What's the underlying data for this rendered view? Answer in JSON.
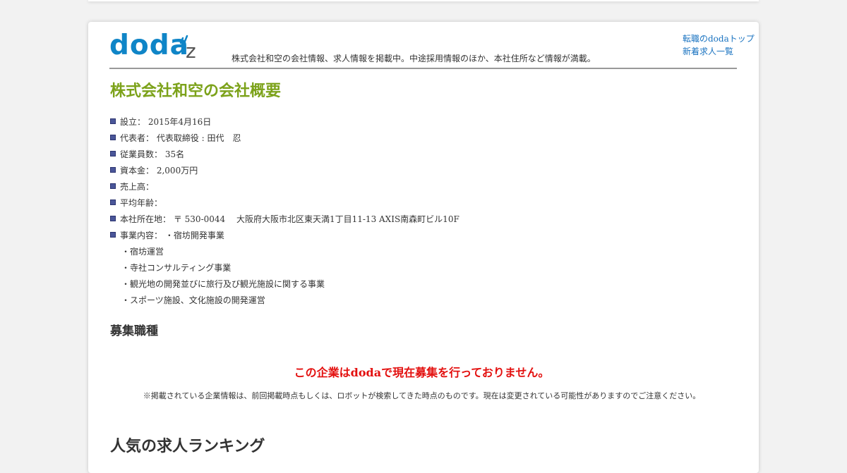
{
  "header": {
    "logo_text": "doda",
    "logo_suffix": "z",
    "tagline": "株式会社和空の会社情報、求人情報を掲載中。中途採用情報のほか、本社住所など情報が満載。",
    "links": [
      "転職のdodaトップ",
      "新着求人一覧"
    ]
  },
  "page_title": "株式会社和空の会社概要",
  "company_info": [
    {
      "label": "設立：",
      "value": "2015年4月16日"
    },
    {
      "label": "代表者：",
      "value": "代表取締役 : 田代　忍"
    },
    {
      "label": "従業員数：",
      "value": "35名"
    },
    {
      "label": "資本金：",
      "value": "2,000万円"
    },
    {
      "label": "売上高：",
      "value": ""
    },
    {
      "label": "平均年齢：",
      "value": ""
    },
    {
      "label": "本社所在地：",
      "value": "〒 530-0044　 大阪府大阪市北区東天満1丁目11-13 AXIS南森町ビル10F"
    },
    {
      "label": "事業内容：",
      "value": "・宿坊開発事業"
    }
  ],
  "business_items": [
    "・宿坊運営",
    "・寺社コンサルティング事業",
    "・観光地の開発並びに旅行及び観光施設に関する事業",
    "・スポーツ施設、文化施設の開発運営"
  ],
  "section_heading": "募集職種",
  "notice": "この企業はdodaで現在募集を行っておりません。",
  "disclaimer": "※掲載されている企業情報は、前回掲載時点もしくは、ロボットが検索してきた時点のものです。現在は変更されている可能性がありますのでご注意ください。",
  "ranking_heading": "人気の求人ランキング",
  "colors": {
    "logo_blue": "#0f85c7",
    "title_green": "#7ca21a",
    "notice_red": "#e3100f",
    "link_blue": "#1a73c0"
  }
}
